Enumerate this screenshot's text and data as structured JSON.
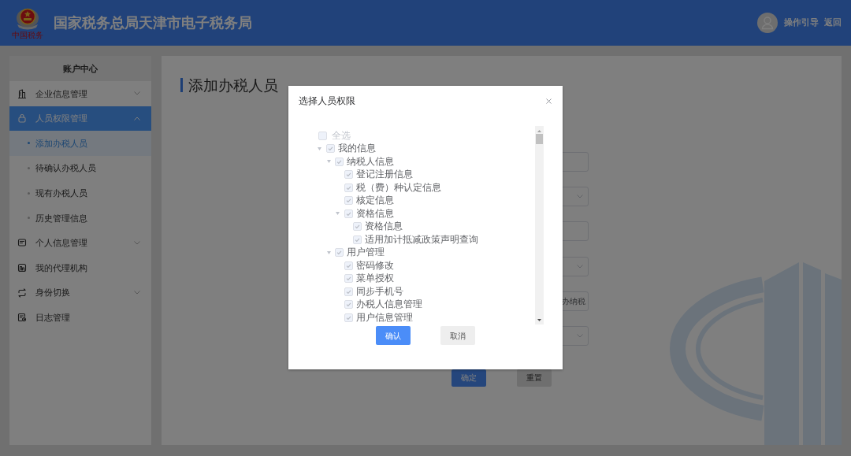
{
  "header": {
    "logo_text": "中国税务",
    "title": "国家税务总局天津市电子税务局",
    "links": [
      "操作引导",
      "返回"
    ]
  },
  "sidebar": {
    "title": "账户中心",
    "items": [
      {
        "label": "企业信息管理",
        "selected": false,
        "expanded": false
      },
      {
        "label": "人员权限管理",
        "selected": true,
        "expanded": true,
        "children": [
          {
            "label": "添加办税人员",
            "selected": true
          },
          {
            "label": "待确认办税人员",
            "selected": false
          },
          {
            "label": "现有办税人员",
            "selected": false
          },
          {
            "label": "历史管理信息",
            "selected": false
          }
        ]
      },
      {
        "label": "个人信息管理",
        "selected": false,
        "expanded": false
      },
      {
        "label": "我的代理机构",
        "selected": false
      },
      {
        "label": "身份切换",
        "selected": false,
        "expanded": false
      },
      {
        "label": "日志管理",
        "selected": false
      }
    ]
  },
  "main": {
    "title": "添加办税人员",
    "form_fields": [
      {
        "kind": "input"
      },
      {
        "kind": "select"
      },
      {
        "kind": "input"
      },
      {
        "kind": "select"
      },
      {
        "kind": "input",
        "value": "办纳税"
      },
      {
        "kind": "select"
      }
    ],
    "buttons": [
      {
        "label": "确定",
        "kind": "primary"
      },
      {
        "label": "重置",
        "kind": "default"
      }
    ]
  },
  "dialog": {
    "title": "选择人员权限",
    "select_all": {
      "label": "全选",
      "checked": false,
      "disabled": true
    },
    "tree": [
      {
        "label": "我的信息",
        "checked": true,
        "expanded": true,
        "children": [
          {
            "label": "纳税人信息",
            "checked": true,
            "expanded": true,
            "children": [
              {
                "label": "登记注册信息",
                "checked": true
              },
              {
                "label": "税（费）种认定信息",
                "checked": true
              },
              {
                "label": "核定信息",
                "checked": true
              },
              {
                "label": "资格信息",
                "checked": true,
                "expanded": true,
                "children": [
                  {
                    "label": "资格信息",
                    "checked": true
                  },
                  {
                    "label": "适用加计抵减政策声明查询",
                    "checked": true
                  }
                ]
              }
            ]
          },
          {
            "label": "用户管理",
            "checked": true,
            "expanded": true,
            "children": [
              {
                "label": "密码修改",
                "checked": true
              },
              {
                "label": "菜单授权",
                "checked": true
              },
              {
                "label": "同步手机号",
                "checked": true
              },
              {
                "label": "办税人信息管理",
                "checked": true
              },
              {
                "label": "用户信息管理",
                "checked": true
              }
            ]
          }
        ]
      }
    ],
    "buttons": [
      {
        "label": "确认",
        "kind": "primary"
      },
      {
        "label": "取消",
        "kind": "default"
      }
    ]
  }
}
